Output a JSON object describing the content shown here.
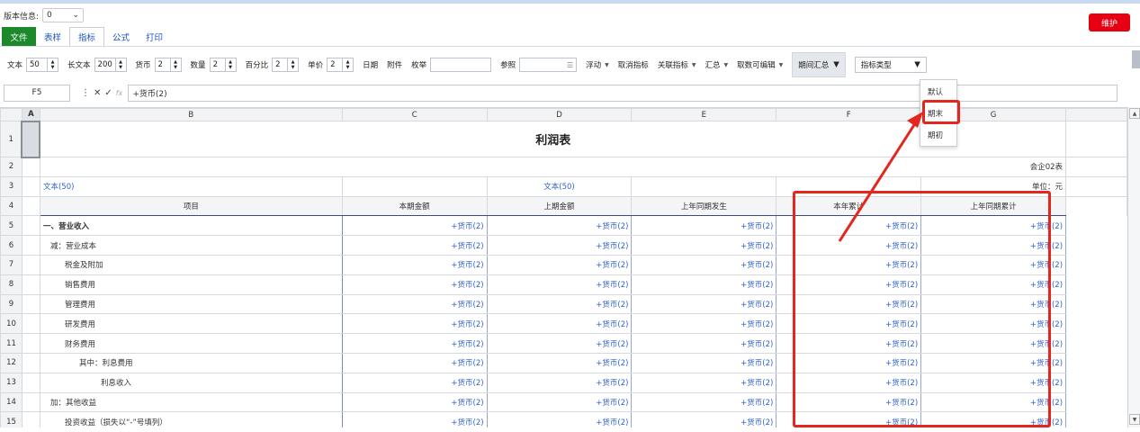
{
  "version": {
    "label": "版本信息:",
    "value": "0"
  },
  "maintain_label": "维护",
  "tabs": [
    {
      "label": "文件"
    },
    {
      "label": "表样"
    },
    {
      "label": "指标"
    },
    {
      "label": "公式"
    },
    {
      "label": "打印"
    }
  ],
  "toolbar": {
    "text": {
      "label": "文本",
      "value": "50"
    },
    "longtext": {
      "label": "长文本",
      "value": "200"
    },
    "currency": {
      "label": "货币",
      "value": "2"
    },
    "quantity": {
      "label": "数量",
      "value": "2"
    },
    "percent": {
      "label": "百分比",
      "value": "2"
    },
    "price": {
      "label": "单价",
      "value": "2"
    },
    "date": "日期",
    "attach": "附件",
    "enum": "枚举",
    "ref": "参照",
    "float": "浮动",
    "cancel": "取消指标",
    "related": "关联指标",
    "summary": "汇总",
    "editable": "取数可编辑",
    "period": "期间汇总",
    "type": "指标类型"
  },
  "cellref": "F5",
  "formula": "+货币(2)",
  "columns": [
    "A",
    "B",
    "C",
    "D",
    "E",
    "F",
    "G"
  ],
  "sheet": {
    "title": "利润表",
    "form_no": "会企02表",
    "row3_b": "文本(50)",
    "row3_d": "文本(50)",
    "unit": "单位：元",
    "headers": [
      "项目",
      "本期金额",
      "上期金额",
      "上年同期发生",
      "本年累计",
      "上年同期累计"
    ],
    "cell": "+货币(2)",
    "items": [
      "一、营业收入",
      "减：营业成本",
      "税金及附加",
      "销售费用",
      "管理费用",
      "研发费用",
      "财务费用",
      "其中：利息费用",
      "利息收入",
      "加：其他收益",
      "投资收益（损失以“-”号填列）"
    ]
  },
  "menu": [
    {
      "label": "默认"
    },
    {
      "label": "期末"
    },
    {
      "label": "期初"
    }
  ],
  "colors": {
    "highlight": "#e3261e",
    "file_tab": "#1c8a2a",
    "maintain": "#e60012"
  }
}
